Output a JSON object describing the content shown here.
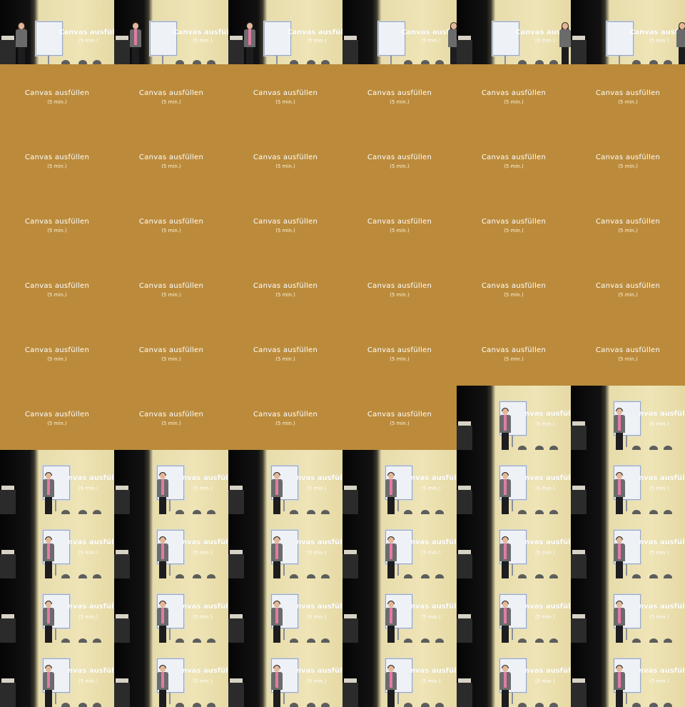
{
  "slide": {
    "title": "Canvas ausfüllen",
    "subtitle": "(5 min.)",
    "background_color": "#bb8b3b"
  },
  "stage_overlay": {
    "title_fragment": "nvas ausfülle",
    "subtitle": "(5 min.)"
  },
  "frames": [
    {
      "type": "stage",
      "presenter": "woman"
    },
    {
      "type": "stage",
      "presenter": "man-left"
    },
    {
      "type": "stage",
      "presenter": "man-left"
    },
    {
      "type": "stage",
      "presenter": "woman-right"
    },
    {
      "type": "stage",
      "presenter": "woman-left"
    },
    {
      "type": "stage",
      "presenter": "woman-right"
    },
    {
      "type": "slide"
    },
    {
      "type": "slide"
    },
    {
      "type": "slide"
    },
    {
      "type": "slide"
    },
    {
      "type": "slide"
    },
    {
      "type": "slide"
    },
    {
      "type": "slide"
    },
    {
      "type": "slide"
    },
    {
      "type": "slide"
    },
    {
      "type": "slide"
    },
    {
      "type": "slide"
    },
    {
      "type": "slide"
    },
    {
      "type": "slide"
    },
    {
      "type": "slide"
    },
    {
      "type": "slide"
    },
    {
      "type": "slide"
    },
    {
      "type": "slide"
    },
    {
      "type": "slide"
    },
    {
      "type": "slide"
    },
    {
      "type": "slide"
    },
    {
      "type": "slide"
    },
    {
      "type": "slide"
    },
    {
      "type": "slide"
    },
    {
      "type": "slide"
    },
    {
      "type": "slide"
    },
    {
      "type": "slide"
    },
    {
      "type": "slide"
    },
    {
      "type": "slide"
    },
    {
      "type": "slide"
    },
    {
      "type": "slide"
    },
    {
      "type": "slide"
    },
    {
      "type": "slide"
    },
    {
      "type": "slide"
    },
    {
      "type": "slide"
    },
    {
      "type": "stage",
      "presenter": "man"
    },
    {
      "type": "stage",
      "presenter": "man"
    },
    {
      "type": "stage",
      "presenter": "man"
    },
    {
      "type": "stage",
      "presenter": "man"
    },
    {
      "type": "stage",
      "presenter": "man"
    },
    {
      "type": "stage",
      "presenter": "man"
    },
    {
      "type": "stage",
      "presenter": "man"
    },
    {
      "type": "stage",
      "presenter": "man"
    },
    {
      "type": "stage",
      "presenter": "man"
    },
    {
      "type": "stage",
      "presenter": "man"
    },
    {
      "type": "stage",
      "presenter": "man"
    },
    {
      "type": "stage",
      "presenter": "man"
    },
    {
      "type": "stage",
      "presenter": "man"
    },
    {
      "type": "stage",
      "presenter": "man"
    },
    {
      "type": "stage",
      "presenter": "man"
    },
    {
      "type": "stage",
      "presenter": "man"
    },
    {
      "type": "stage",
      "presenter": "man"
    },
    {
      "type": "stage",
      "presenter": "man"
    },
    {
      "type": "stage",
      "presenter": "man"
    },
    {
      "type": "stage",
      "presenter": "man"
    },
    {
      "type": "stage",
      "presenter": "man"
    },
    {
      "type": "stage",
      "presenter": "man"
    },
    {
      "type": "stage",
      "presenter": "man"
    },
    {
      "type": "stage",
      "presenter": "man"
    },
    {
      "type": "stage",
      "presenter": "man"
    },
    {
      "type": "stage",
      "presenter": "man"
    }
  ]
}
